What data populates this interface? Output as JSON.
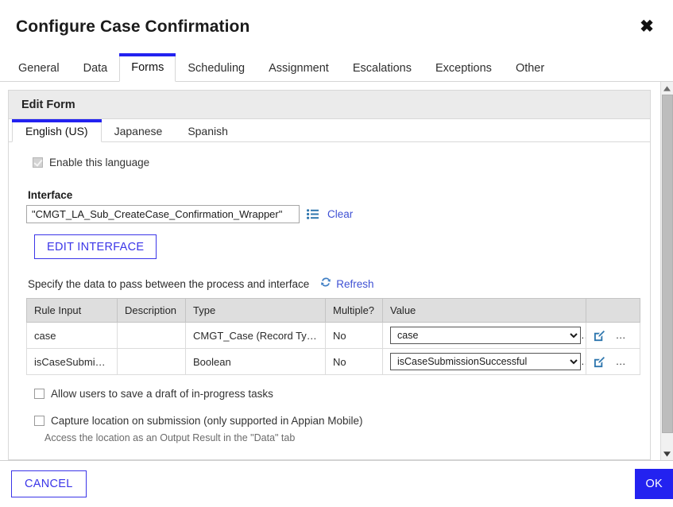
{
  "dialog": {
    "title": "Configure Case Confirmation",
    "close_icon": "close-icon"
  },
  "tabs": [
    {
      "label": "General",
      "active": false
    },
    {
      "label": "Data",
      "active": false
    },
    {
      "label": "Forms",
      "active": true
    },
    {
      "label": "Scheduling",
      "active": false
    },
    {
      "label": "Assignment",
      "active": false
    },
    {
      "label": "Escalations",
      "active": false
    },
    {
      "label": "Exceptions",
      "active": false
    },
    {
      "label": "Other",
      "active": false
    }
  ],
  "panel": {
    "header": "Edit Form",
    "language_tabs": [
      {
        "label": "English (US)",
        "active": true
      },
      {
        "label": "Japanese",
        "active": false
      },
      {
        "label": "Spanish",
        "active": false
      }
    ],
    "enable_language": {
      "label": "Enable this language",
      "checked": true,
      "disabled": true
    },
    "interface": {
      "label": "Interface",
      "value": "\"CMGT_LA_Sub_CreateCase_Confirmation_Wrapper\"",
      "placeholder": "",
      "picker_icon": "list-picker-icon",
      "clear_label": "Clear",
      "edit_button": "EDIT INTERFACE"
    },
    "specify": {
      "text": "Specify the data to pass between the process and interface",
      "refresh_label": "Refresh",
      "refresh_icon": "refresh-icon"
    },
    "grid": {
      "columns": [
        "Rule Input",
        "Description",
        "Type",
        "Multiple?",
        "Value",
        ""
      ],
      "rows": [
        {
          "rule_input": "case",
          "description": "",
          "type": "CMGT_Case (Record Type)",
          "multiple": "No",
          "value": "case",
          "edit_icon": "edit-pencil-icon",
          "add_icon": "plus-icon"
        },
        {
          "rule_input": "isCaseSubmiss...",
          "description": "",
          "type": "Boolean",
          "multiple": "No",
          "value": "isCaseSubmissionSuccessful",
          "edit_icon": "edit-pencil-icon",
          "add_icon": "plus-icon"
        }
      ]
    },
    "options": {
      "allow_draft": {
        "label": "Allow users to save a draft of in-progress tasks",
        "checked": false
      },
      "capture_location": {
        "label": "Capture location on submission (only supported in Appian Mobile)",
        "checked": false
      },
      "capture_location_hint": "Access the location as an Output Result in the \"Data\" tab"
    }
  },
  "footer": {
    "cancel_label": "CANCEL",
    "ok_label": "OK"
  },
  "colors": {
    "accent": "#2322f0",
    "link": "#3f51d4",
    "icon_blue": "#2e76ae",
    "header_bg": "#ebebeb",
    "grid_header_bg": "#dedede"
  }
}
